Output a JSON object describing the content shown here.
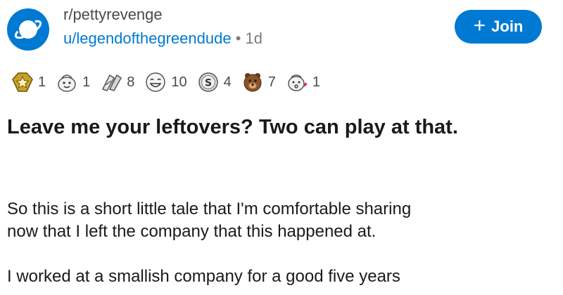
{
  "post": {
    "subreddit": "r/pettyrevenge",
    "username": "u/legendofthegreendude",
    "separator": "•",
    "age": "1d",
    "join_label": "Join",
    "join_icon": "plus-icon",
    "title": "Leave me your leftovers? Two can play at that.",
    "body": [
      [
        "So this is a short little tale that I'm comfortable sharing",
        "now that I left the company that this happened at."
      ],
      [
        "I worked at a smallish company for a good five years"
      ]
    ]
  },
  "awards": [
    {
      "icon": "star-badge-icon",
      "count": "1"
    },
    {
      "icon": "wholesome-face-icon",
      "count": "1"
    },
    {
      "icon": "helpful-hands-icon",
      "count": "8"
    },
    {
      "icon": "laughing-face-icon",
      "count": "10"
    },
    {
      "icon": "silver-coin-icon",
      "count": "4"
    },
    {
      "icon": "bear-icon",
      "count": "7"
    },
    {
      "icon": "blowing-kiss-icon",
      "count": "1"
    }
  ],
  "colors": {
    "accent": "#0079d3",
    "text": "#1a1a1b",
    "muted": "#7c7c7c"
  }
}
